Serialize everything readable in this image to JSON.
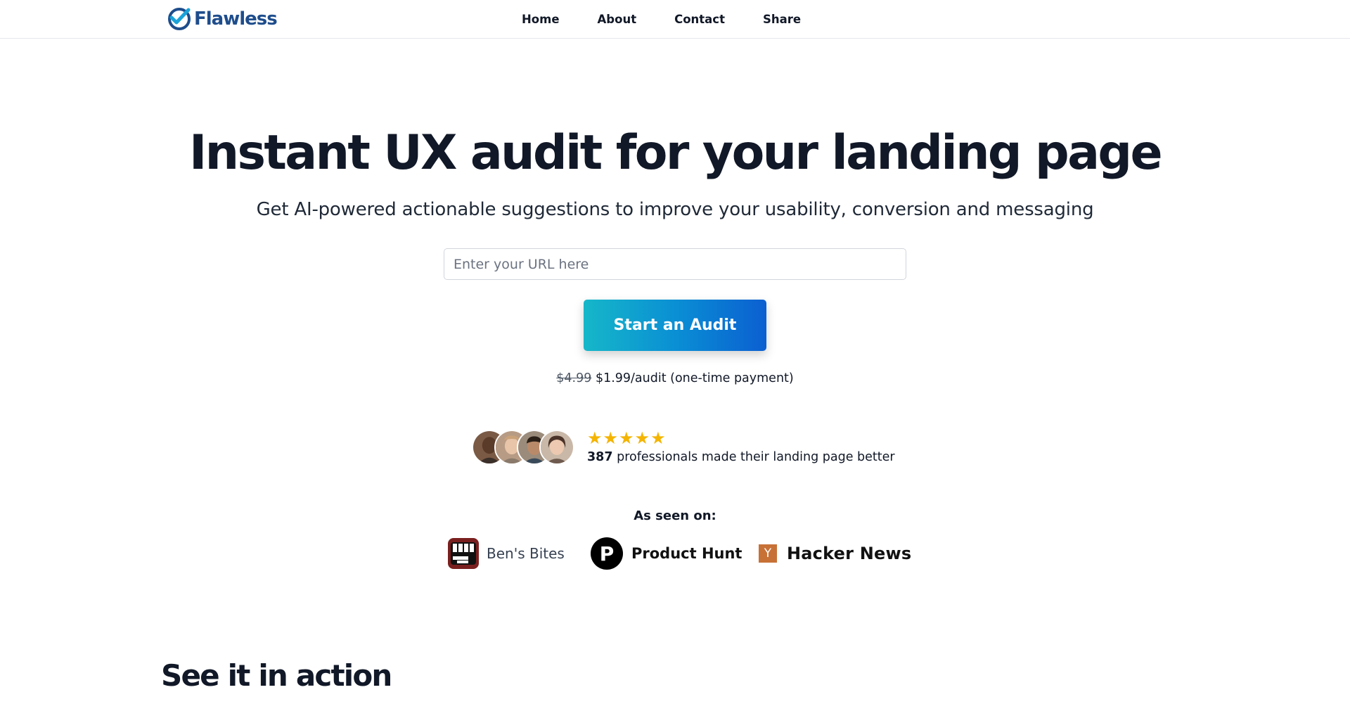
{
  "brand": {
    "name": "Flawless",
    "colors": {
      "brand": "#1e4d8c",
      "accent": "#1aa3d9",
      "cta_start": "#16b7c9",
      "cta_end": "#0b5fd1",
      "star": "#f4b400"
    }
  },
  "nav": {
    "items": [
      {
        "label": "Home"
      },
      {
        "label": "About"
      },
      {
        "label": "Contact"
      },
      {
        "label": "Share"
      }
    ]
  },
  "hero": {
    "title": "Instant UX audit for your landing page",
    "subtitle": "Get AI-powered actionable suggestions to improve your usability, conversion and messaging",
    "url_input": {
      "placeholder": "Enter your URL here",
      "value": ""
    },
    "cta_label": "Start an Audit",
    "pricing": {
      "old_price": "$4.99",
      "new_price": "$1.99/audit (one-time payment)"
    }
  },
  "social_proof": {
    "rating": 5,
    "count": "387",
    "text": "professionals made their landing page better"
  },
  "press": {
    "label": "As seen on:",
    "items": [
      {
        "name": "Ben's Bites",
        "icon": "bens-bites-icon"
      },
      {
        "name": "Product Hunt",
        "icon": "product-hunt-icon",
        "icon_letter": "P"
      },
      {
        "name": "Hacker News",
        "icon": "hacker-news-icon",
        "icon_letter": "Y"
      }
    ]
  },
  "demo_section": {
    "title": "See it in action"
  }
}
